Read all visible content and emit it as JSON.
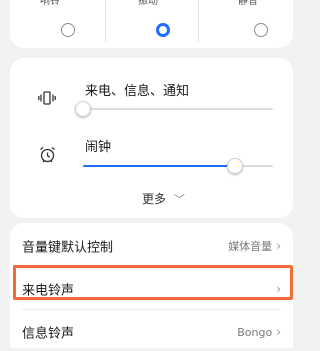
{
  "mode_selector": {
    "labels": [
      "响铃",
      "振动",
      "静音"
    ],
    "selected_index": 1
  },
  "volume": {
    "ringtone_label": "来电、信息、通知",
    "ringtone_level": 0.0,
    "alarm_label": "闹钟",
    "alarm_level": 0.8,
    "more_label": "更多",
    "more_chevron": "﹀"
  },
  "list": {
    "items": [
      {
        "label": "音量键默认控制",
        "value": "媒体音量",
        "chevron": "›"
      },
      {
        "label": "来电铃声",
        "value": "",
        "chevron": "›"
      },
      {
        "label": "信息铃声",
        "value": "Bongo",
        "chevron": "›"
      }
    ]
  },
  "colors": {
    "accent": "#1f6dff",
    "highlight": "#f06b3a"
  },
  "icons": {
    "ringtone_icon": "vibrate-icon",
    "alarm_icon": "alarm-clock-icon"
  }
}
